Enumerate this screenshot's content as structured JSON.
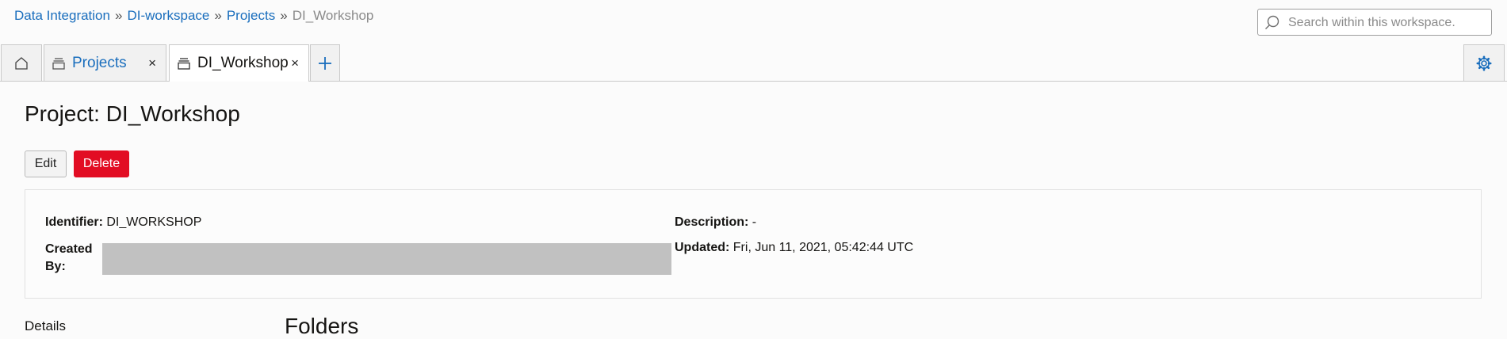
{
  "breadcrumb": {
    "items": [
      "Data Integration",
      "DI-workspace",
      "Projects"
    ],
    "current": "DI_Workshop",
    "separator": "»"
  },
  "search": {
    "placeholder": "Search within this workspace."
  },
  "tabs": {
    "home_icon": "home-icon",
    "projects": {
      "label": "Projects",
      "icon": "stack-icon",
      "close": "×"
    },
    "workshop": {
      "label": "DI_Workshop",
      "icon": "stack-icon",
      "close": "×"
    },
    "add_icon": "plus-icon",
    "settings_icon": "gear-icon"
  },
  "page": {
    "title": "Project: DI_Workshop",
    "edit_label": "Edit",
    "delete_label": "Delete"
  },
  "details": {
    "identifier_label": "Identifier:",
    "identifier_value": "DI_WORKSHOP",
    "description_label": "Description:",
    "description_value": "-",
    "created_by_label": "Created By:",
    "updated_label": "Updated:",
    "updated_value": "Fri, Jun 11, 2021, 05:42:44 UTC"
  },
  "sidebar": {
    "details_label": "Details"
  },
  "main": {
    "folders_heading": "Folders"
  },
  "colors": {
    "link": "#1a6ebd",
    "danger": "#e20d23",
    "redaction": "#c1c1c1"
  }
}
